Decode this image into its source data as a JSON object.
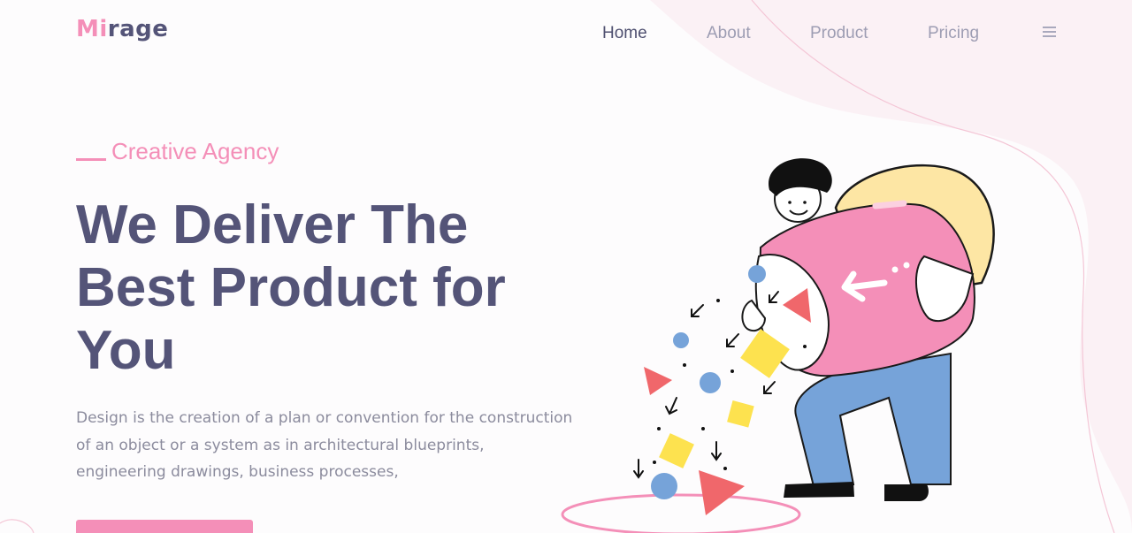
{
  "brand": {
    "prefix": "Mi",
    "suffix": "rage"
  },
  "nav": {
    "items": [
      {
        "label": "Home",
        "active": true
      },
      {
        "label": "About",
        "active": false
      },
      {
        "label": "Product",
        "active": false
      },
      {
        "label": "Pricing",
        "active": false
      }
    ],
    "menu_icon": "hamburger-icon"
  },
  "hero": {
    "eyebrow": "Creative Agency",
    "headline_lines": [
      "We Deliver The",
      "Best Product for",
      "You"
    ],
    "description_lines": [
      "Design is the creation of a plan or convention for the construction",
      "of an object or a system as in architectural blueprints,",
      "engineering drawings, business processes,"
    ]
  },
  "colors": {
    "brand_pink": "#f48fb8",
    "text_dark": "#545478",
    "text_muted": "#8b8b9d",
    "bg_blob": "#fbf1f5",
    "yellow": "#fde6a4",
    "blue": "#76a3d9",
    "red": "#f0676b",
    "shape_yellow": "#fde24f"
  }
}
